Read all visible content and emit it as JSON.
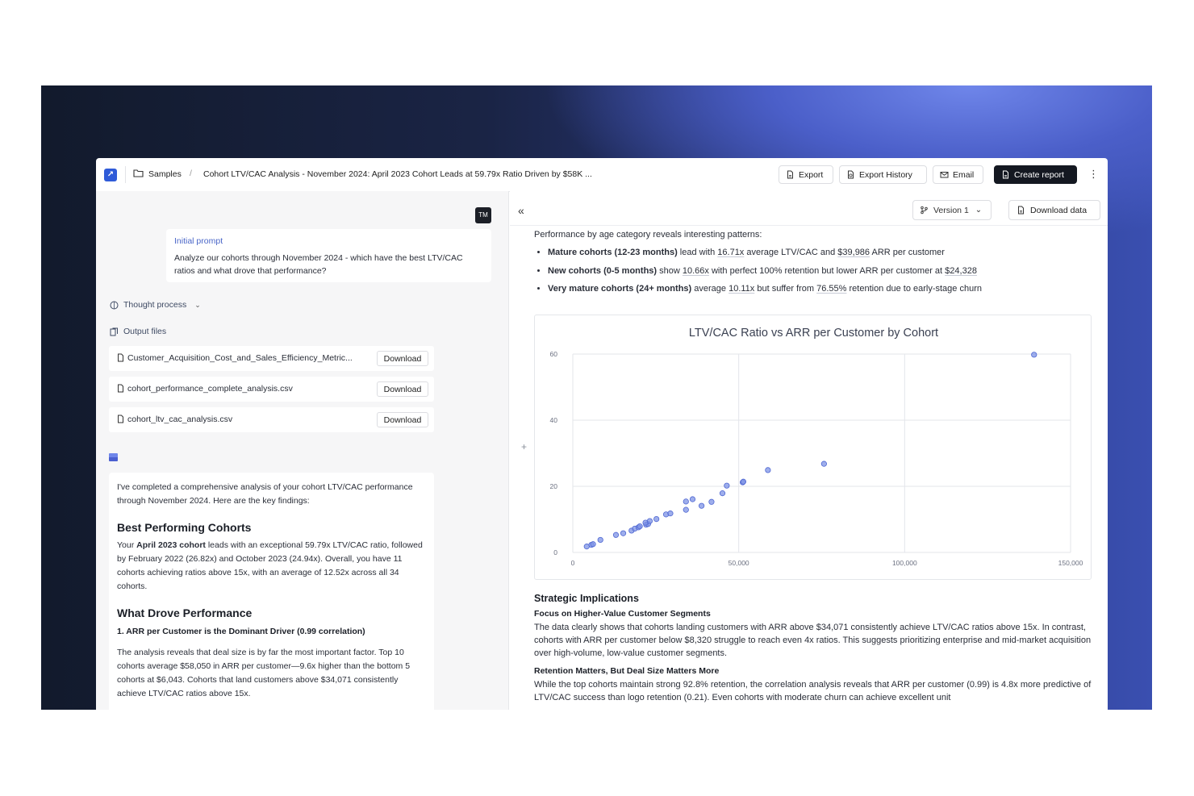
{
  "topbar": {
    "breadcrumb_root": "Samples",
    "report_title": "Cohort LTV/CAC Analysis - November 2024: April 2023 Cohort Leads at 59.79x Ratio Driven by $58K ...",
    "export_label": "Export",
    "export_history_label": "Export History",
    "email_label": "Email",
    "create_report_label": "Create report"
  },
  "chat": {
    "avatar_initials": "TM",
    "prompt_label": "Initial prompt",
    "prompt_text": "Analyze our cohorts through November 2024 - which have the best LTV/CAC ratios and what drove that performance?",
    "thought_process_label": "Thought process",
    "output_files_label": "Output files",
    "files": [
      {
        "name": "Customer_Acquisition_Cost_and_Sales_Efficiency_Metric...",
        "action": "Download"
      },
      {
        "name": "cohort_performance_complete_analysis.csv",
        "action": "Download"
      },
      {
        "name": "cohort_ltv_cac_analysis.csv",
        "action": "Download"
      }
    ],
    "answer": {
      "intro": "I've completed a comprehensive analysis of your cohort LTV/CAC performance through November 2024. Here are the key findings:",
      "h_best": "Best Performing Cohorts",
      "best_pre": "Your ",
      "best_bold": "April 2023 cohort",
      "best_post": " leads with an exceptional 59.79x LTV/CAC ratio, followed by February 2022 (26.82x) and October 2023 (24.94x). Overall, you have 11 cohorts achieving ratios above 15x, with an average of 12.52x across all 34 cohorts.",
      "h_drove": "What Drove Performance",
      "driver1": "1. ARR per Customer is the Dominant Driver (0.99 correlation)",
      "driver1_text": "The analysis reveals that deal size is by far the most important factor. Top 10 cohorts average $58,050 in ARR per customer—9.6x higher than the bottom 5 cohorts at $6,043. Cohorts that land customers above $34,071 consistently achieve LTV/CAC ratios above 15x."
    }
  },
  "report": {
    "version_label": "Version 1",
    "download_data_label": "Download data",
    "intro": "Performance by age category reveals interesting patterns:",
    "bullets": [
      {
        "bold": "Mature cohorts (12-23 months)",
        "a": " lead with ",
        "v1": "16.71x",
        "b": " average LTV/CAC and ",
        "v2": "$39,986",
        "c": " ARR per customer"
      },
      {
        "bold": "New cohorts (0-5 months)",
        "a": " show ",
        "v1": "10.66x",
        "b": " with perfect 100% retention but lower ARR per customer at ",
        "v2": "$24,328",
        "c": ""
      },
      {
        "bold": "Very mature cohorts (24+ months)",
        "a": " average ",
        "v1": "10.11x",
        "b": " but suffer from ",
        "v2": "76.55%",
        "c": " retention due to early-stage churn"
      }
    ],
    "strategic_title": "Strategic Implications",
    "focus_title": "Focus on Higher-Value Customer Segments",
    "focus_text": "The data clearly shows that cohorts landing customers with ARR above $34,071 consistently achieve LTV/CAC ratios above 15x. In contrast, cohorts with ARR per customer below $8,320 struggle to reach even 4x ratios. This suggests prioritizing enterprise and mid-market acquisition over high-volume, low-value customer segments.",
    "retention_title": "Retention Matters, But Deal Size Matters More",
    "retention_text": "While the top cohorts maintain strong 92.8% retention, the correlation analysis reveals that ARR per customer (0.99) is 4.8x more predictive of LTV/CAC success than logo retention (0.21). Even cohorts with moderate churn can achieve excellent unit"
  },
  "colors": {
    "accent": "#4a66c8",
    "point": "#7d93e6",
    "point_stroke": "#4f67d2",
    "dark_button": "#141821"
  },
  "chart_data": {
    "type": "scatter",
    "title": "LTV/CAC Ratio vs ARR per Customer by Cohort",
    "xlim": [
      0,
      150000
    ],
    "ylim": [
      0,
      60
    ],
    "x_ticks": [
      "0",
      "50,000",
      "100,000",
      "150,000"
    ],
    "y_ticks": [
      "0",
      "20",
      "40",
      "60"
    ],
    "grid": true,
    "points": [
      {
        "x": 4200,
        "y": 1.8
      },
      {
        "x": 5600,
        "y": 2.3
      },
      {
        "x": 6100,
        "y": 2.5
      },
      {
        "x": 8320,
        "y": 3.8
      },
      {
        "x": 13000,
        "y": 5.3
      },
      {
        "x": 15200,
        "y": 5.8
      },
      {
        "x": 17700,
        "y": 6.6
      },
      {
        "x": 18700,
        "y": 7.2
      },
      {
        "x": 19800,
        "y": 7.6
      },
      {
        "x": 20200,
        "y": 7.9
      },
      {
        "x": 22100,
        "y": 8.4
      },
      {
        "x": 22700,
        "y": 8.6
      },
      {
        "x": 21900,
        "y": 9.0
      },
      {
        "x": 23200,
        "y": 9.5
      },
      {
        "x": 25200,
        "y": 10.1
      },
      {
        "x": 28100,
        "y": 11.5
      },
      {
        "x": 29400,
        "y": 11.8
      },
      {
        "x": 34100,
        "y": 12.9
      },
      {
        "x": 34100,
        "y": 15.4
      },
      {
        "x": 36100,
        "y": 16.1
      },
      {
        "x": 38800,
        "y": 14.1
      },
      {
        "x": 41800,
        "y": 15.3
      },
      {
        "x": 45100,
        "y": 17.9
      },
      {
        "x": 46400,
        "y": 20.2
      },
      {
        "x": 51200,
        "y": 21.2
      },
      {
        "x": 51400,
        "y": 21.4
      },
      {
        "x": 58800,
        "y": 24.9
      },
      {
        "x": 75700,
        "y": 26.8
      },
      {
        "x": 139000,
        "y": 59.8
      }
    ]
  }
}
